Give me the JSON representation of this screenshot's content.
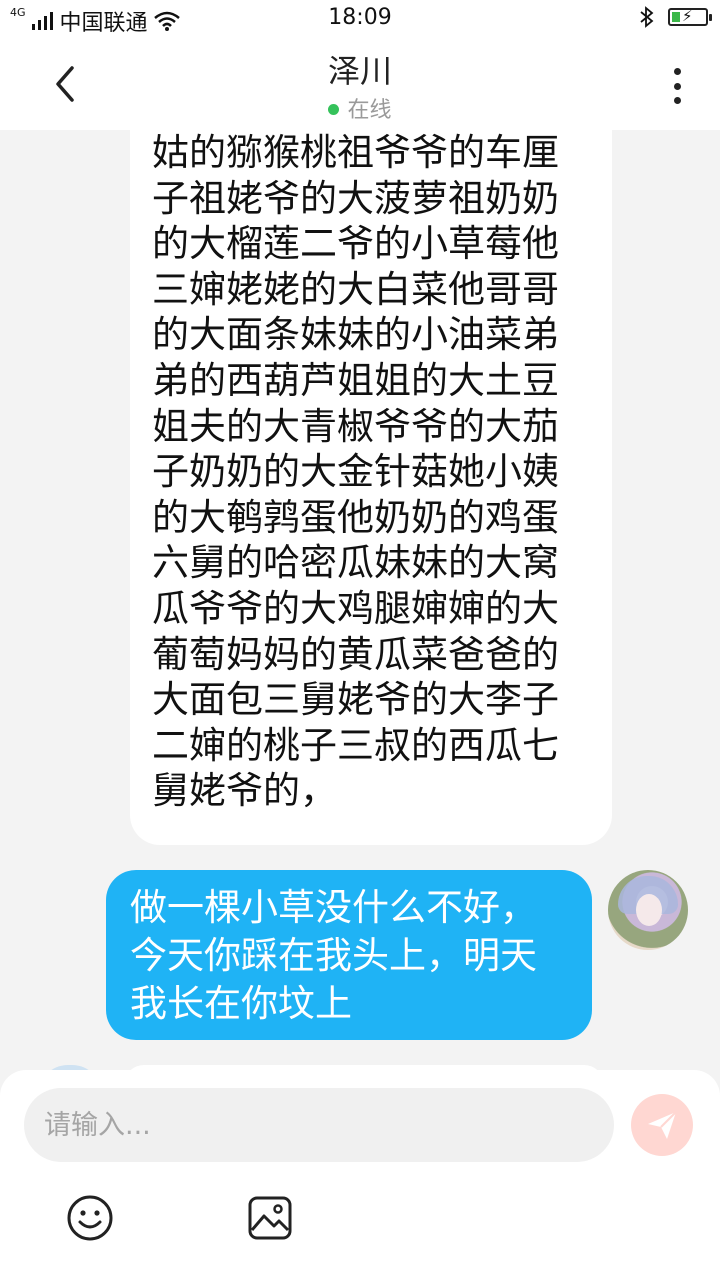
{
  "status_bar": {
    "network": "4G",
    "carrier": "中国联通",
    "time": "18:09",
    "icons": [
      "signal-icon",
      "wifi-icon",
      "bluetooth-icon",
      "battery-charging-icon"
    ]
  },
  "header": {
    "title": "泽川",
    "status": "在线",
    "status_color": "#35c25b"
  },
  "messages": [
    {
      "direction": "incoming",
      "text": "姑的猕猴桃祖爷爷的车厘子祖姥爷的大菠萝祖奶奶的大榴莲二爷的小草莓他三婶姥姥的大白菜他哥哥的大面条妹妹的小油菜弟弟的西葫芦姐姐的大土豆姐夫的大青椒爷爷的大茄子奶奶的大金针菇她小姨的大鹌鹑蛋他奶奶的鸡蛋六舅的哈密瓜妹妹的大窝瓜爷爷的大鸡腿婶婶的大葡萄妈妈的黄瓜菜爸爸的大面包三舅姥爷的大李子二婶的桃子三叔的西瓜七舅姥爷的，"
    },
    {
      "direction": "outgoing",
      "text": "做一棵小草没什么不好，今天你踩在我头上，明天我长在你坟上",
      "bubble_color": "#1fb3f5"
    }
  ],
  "composer": {
    "placeholder": "请输入...",
    "value": "",
    "send_color": "#ffd7d2"
  }
}
